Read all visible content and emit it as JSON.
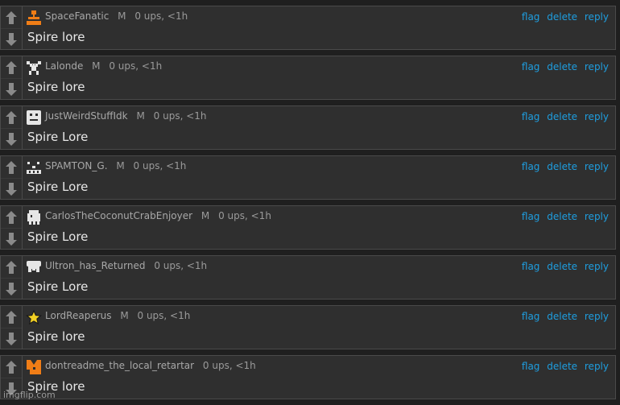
{
  "actions": {
    "flag": "flag",
    "delete": "delete",
    "reply": "reply"
  },
  "comments": [
    {
      "username": "SpaceFanatic",
      "badge": "M",
      "stats": "0 ups, <1h",
      "text": "Spire lore",
      "avatar_icon": "orange-pixel-figure-icon"
    },
    {
      "username": "Lalonde",
      "badge": "M",
      "stats": "0 ups, <1h",
      "text": "Spire lore",
      "avatar_icon": "white-pixel-creature-icon"
    },
    {
      "username": "JustWeirdStuffIdk",
      "badge": "M",
      "stats": "0 ups, <1h",
      "text": "Spire Lore",
      "avatar_icon": "white-pixel-face-icon"
    },
    {
      "username": "SPAMTON_G.",
      "badge": "M",
      "stats": "0 ups, <1h",
      "text": "Spire Lore",
      "avatar_icon": "white-pixel-grin-icon"
    },
    {
      "username": "CarlosTheCoconutCrabEnjoyer",
      "badge": "M",
      "stats": "0 ups, <1h",
      "text": "Spire Lore",
      "avatar_icon": "white-pixel-blob-icon"
    },
    {
      "username": "Ultron_has_Returned",
      "badge": "",
      "stats": "0 ups, <1h",
      "text": "Spire Lore",
      "avatar_icon": "white-pixel-helmet-icon"
    },
    {
      "username": "LordReaperus",
      "badge": "M",
      "stats": "0 ups, <1h",
      "text": "Spire lore",
      "avatar_icon": "star-icon"
    },
    {
      "username": "dontreadme_the_local_retartar",
      "badge": "",
      "stats": "0 ups, <1h",
      "text": "Spire lore",
      "avatar_icon": "orange-pixel-fox-icon"
    }
  ],
  "watermark": "imgflip.com",
  "colors": {
    "link": "#1e9ee0",
    "background": "#1f1f1f",
    "panel": "#2f2f2f",
    "orange": "#f07d16"
  }
}
